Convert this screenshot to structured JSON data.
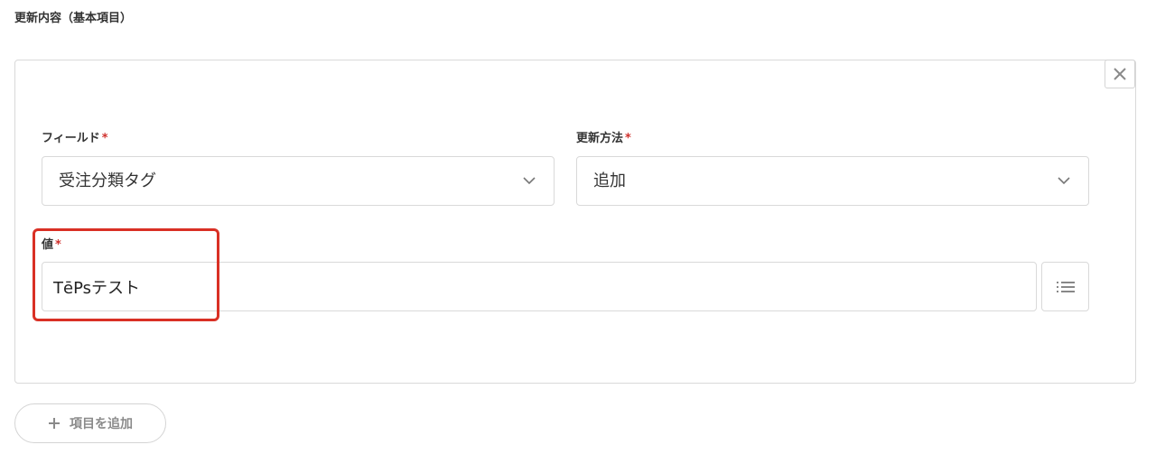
{
  "section": {
    "title": "更新内容（基本項目）"
  },
  "field": {
    "label": "フィールド",
    "required_mark": "*",
    "selected": "受注分類タグ"
  },
  "method": {
    "label": "更新方法",
    "required_mark": "*",
    "selected": "追加"
  },
  "value": {
    "label": "値",
    "required_mark": "*",
    "input_value": "TēPsテスト"
  },
  "actions": {
    "add_item_label": "項目を追加",
    "add_item_icon": "plus-icon",
    "close_icon": "close-icon",
    "list_icon": "list-icon"
  },
  "colors": {
    "required": "#d0312d",
    "highlight": "#d93025",
    "border": "#d9d9d9",
    "muted_text": "#8a8a8a"
  }
}
